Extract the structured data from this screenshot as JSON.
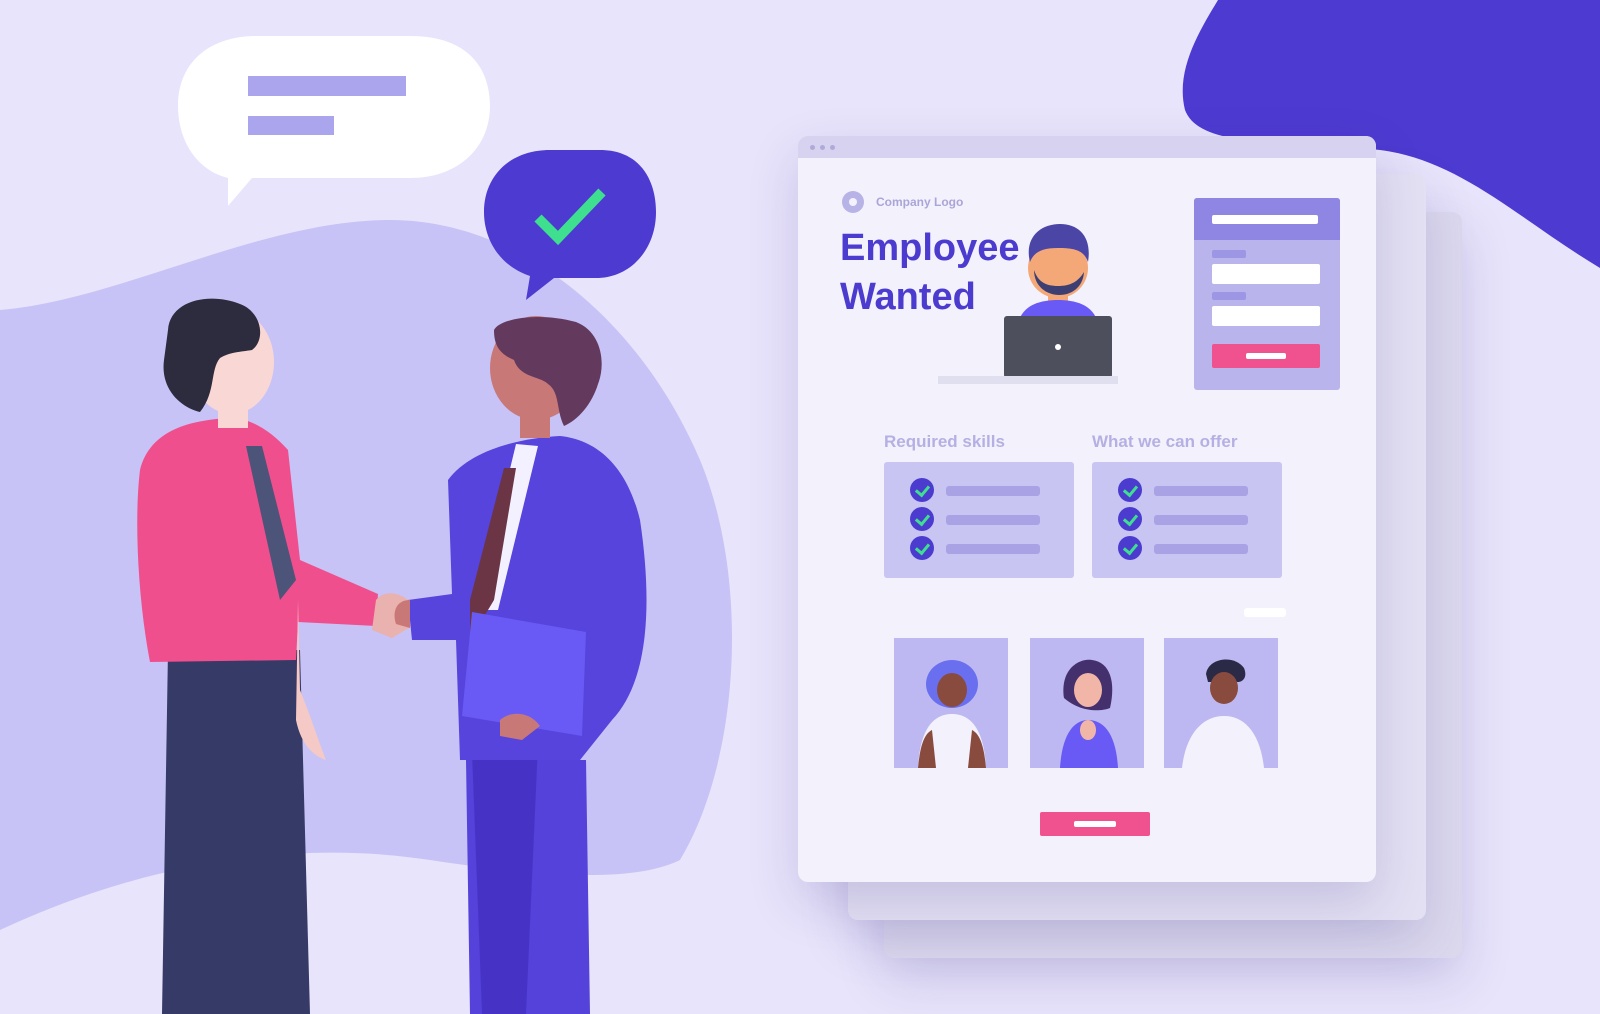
{
  "job_page": {
    "logo_text": "Company Logo",
    "headline": "Employee\nWanted",
    "sections": [
      {
        "title": "Required skills",
        "items": 3
      },
      {
        "title": "What we can offer",
        "items": 3
      }
    ]
  },
  "icons": [
    "speech-bubble-icon",
    "checkmark-icon",
    "laptop-icon",
    "check-circle-icon"
  ],
  "colors": {
    "accent": "#4b3ccf",
    "cta": "#f0528f",
    "check": "#3ee08f",
    "background": "#e8e4fb"
  }
}
